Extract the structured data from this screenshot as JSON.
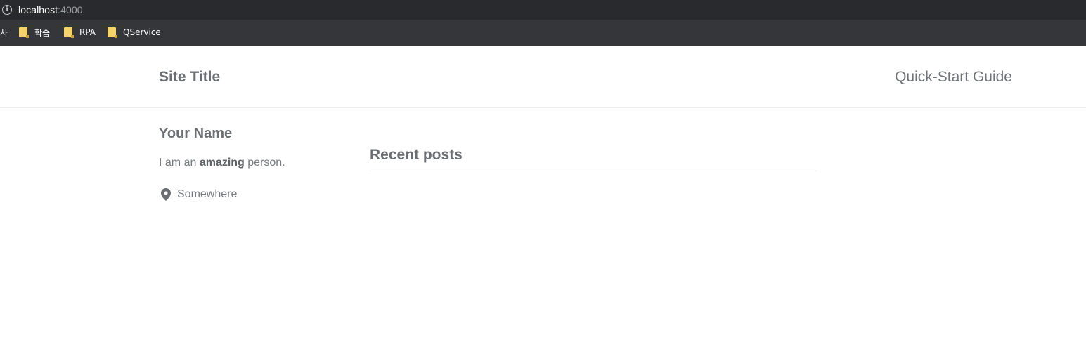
{
  "browser": {
    "url_host": "localhost",
    "url_port": ":4000",
    "bookmarks": [
      {
        "label": "사",
        "icon": "folder-icon"
      },
      {
        "label": "학습",
        "icon": "folder-icon"
      },
      {
        "label": "RPA",
        "icon": "folder-icon"
      },
      {
        "label": "QService",
        "icon": "folder-icon"
      }
    ]
  },
  "header": {
    "site_title": "Site Title",
    "nav_link": "Quick-Start Guide"
  },
  "sidebar": {
    "name": "Your Name",
    "bio_prefix": "I am an",
    "bio_bold": "amazing",
    "bio_suffix": "person.",
    "location": "Somewhere",
    "location_icon": "map-pin-icon"
  },
  "main": {
    "posts_heading": "Recent posts"
  },
  "colors": {
    "chrome_dark": "#292a2d",
    "bookmarks_bar": "#35363a",
    "text_gray": "#6b6f73",
    "folder_yellow": "#f5d36b"
  }
}
